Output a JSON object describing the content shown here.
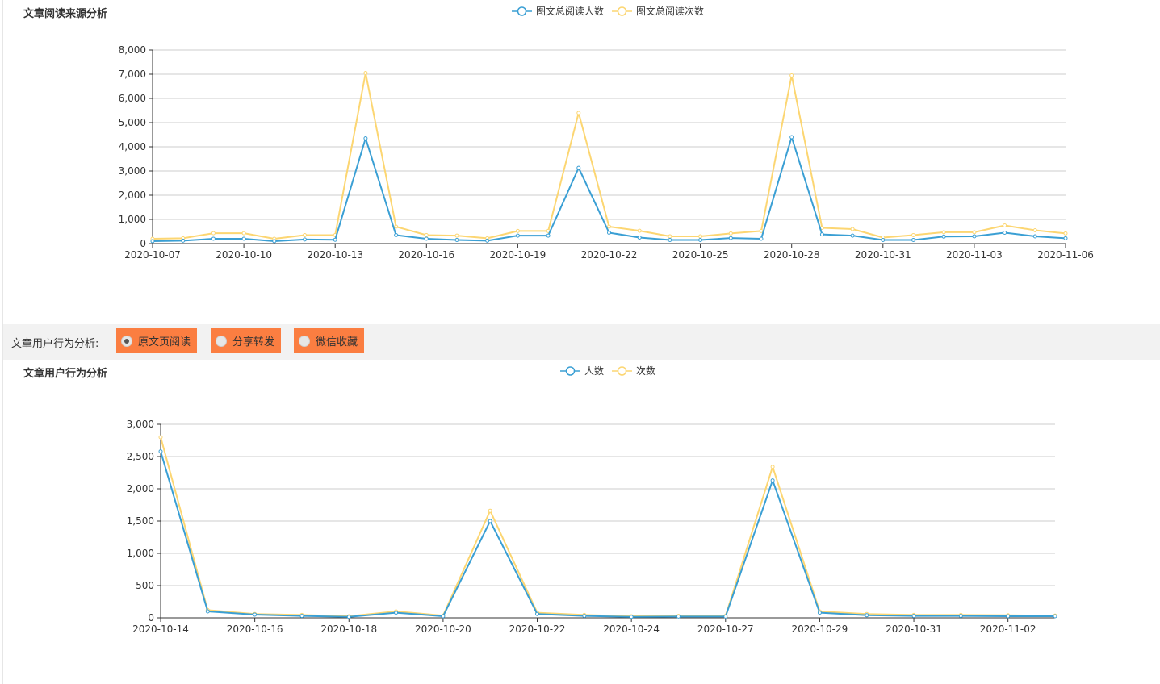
{
  "colors": {
    "series_a": "#3a9fd4",
    "series_b": "#fcd672",
    "accent": "#fb7e41",
    "grid": "#cccccc"
  },
  "toolbar": {
    "label": "文章用户行为分析:",
    "options": [
      {
        "label": "原文页阅读",
        "selected": true
      },
      {
        "label": "分享转发",
        "selected": false
      },
      {
        "label": "微信收藏",
        "selected": false
      }
    ]
  },
  "chart_data": [
    {
      "type": "line",
      "title": "文章阅读来源分析",
      "legend_position": "top-center",
      "grid": true,
      "ylim": [
        0,
        8000
      ],
      "yticks": [
        "0",
        "1,000",
        "2,000",
        "3,000",
        "4,000",
        "5,000",
        "6,000",
        "7,000",
        "8,000"
      ],
      "x": [
        "2020-10-07",
        "2020-10-08",
        "2020-10-09",
        "2020-10-10",
        "2020-10-11",
        "2020-10-12",
        "2020-10-13",
        "2020-10-14",
        "2020-10-15",
        "2020-10-16",
        "2020-10-17",
        "2020-10-18",
        "2020-10-19",
        "2020-10-20",
        "2020-10-21",
        "2020-10-22",
        "2020-10-23",
        "2020-10-24",
        "2020-10-25",
        "2020-10-26",
        "2020-10-27",
        "2020-10-28",
        "2020-10-29",
        "2020-10-30",
        "2020-10-31",
        "2020-11-01",
        "2020-11-02",
        "2020-11-03",
        "2020-11-04",
        "2020-11-05",
        "2020-11-06"
      ],
      "xtick_labels": [
        "2020-10-07",
        "2020-10-10",
        "2020-10-13",
        "2020-10-16",
        "2020-10-19",
        "2020-10-22",
        "2020-10-25",
        "2020-10-28",
        "2020-10-31",
        "2020-11-03",
        "2020-11-06"
      ],
      "series": [
        {
          "name": "图文总阅读人数",
          "values": [
            100,
            120,
            200,
            200,
            100,
            170,
            160,
            4350,
            350,
            200,
            150,
            120,
            330,
            330,
            3130,
            450,
            250,
            150,
            150,
            230,
            200,
            4400,
            380,
            330,
            150,
            150,
            290,
            300,
            450,
            300,
            220
          ]
        },
        {
          "name": "图文总阅读次数",
          "values": [
            200,
            220,
            430,
            430,
            200,
            350,
            350,
            7050,
            700,
            350,
            330,
            220,
            520,
            520,
            5400,
            700,
            530,
            300,
            300,
            420,
            520,
            6950,
            650,
            600,
            250,
            350,
            470,
            470,
            750,
            550,
            420
          ]
        }
      ]
    },
    {
      "type": "line",
      "title": "文章用户行为分析",
      "legend_position": "top-center",
      "grid": true,
      "ylim": [
        0,
        3000
      ],
      "yticks": [
        "0",
        "500",
        "1,000",
        "1,500",
        "2,000",
        "2,500",
        "3,000"
      ],
      "x": [
        "2020-10-14",
        "2020-10-15",
        "2020-10-16",
        "2020-10-17",
        "2020-10-18",
        "2020-10-19",
        "2020-10-20",
        "2020-10-21",
        "2020-10-22",
        "2020-10-23",
        "2020-10-24",
        "2020-10-26",
        "2020-10-27",
        "2020-10-28",
        "2020-10-29",
        "2020-10-30",
        "2020-10-31",
        "2020-11-01",
        "2020-11-02",
        "2020-11-03"
      ],
      "xtick_labels": [
        "2020-10-14",
        "2020-10-16",
        "2020-10-18",
        "2020-10-20",
        "2020-10-22",
        "2020-10-24",
        "2020-10-27",
        "2020-10-29",
        "2020-10-31",
        "2020-11-02"
      ],
      "series": [
        {
          "name": "人数",
          "values": [
            2580,
            100,
            50,
            30,
            15,
            80,
            25,
            1500,
            60,
            30,
            15,
            20,
            20,
            2130,
            80,
            40,
            30,
            30,
            25,
            25
          ]
        },
        {
          "name": "次数",
          "values": [
            2800,
            120,
            60,
            45,
            25,
            100,
            35,
            1660,
            80,
            45,
            25,
            30,
            30,
            2340,
            100,
            60,
            45,
            45,
            40,
            35
          ]
        }
      ]
    }
  ]
}
